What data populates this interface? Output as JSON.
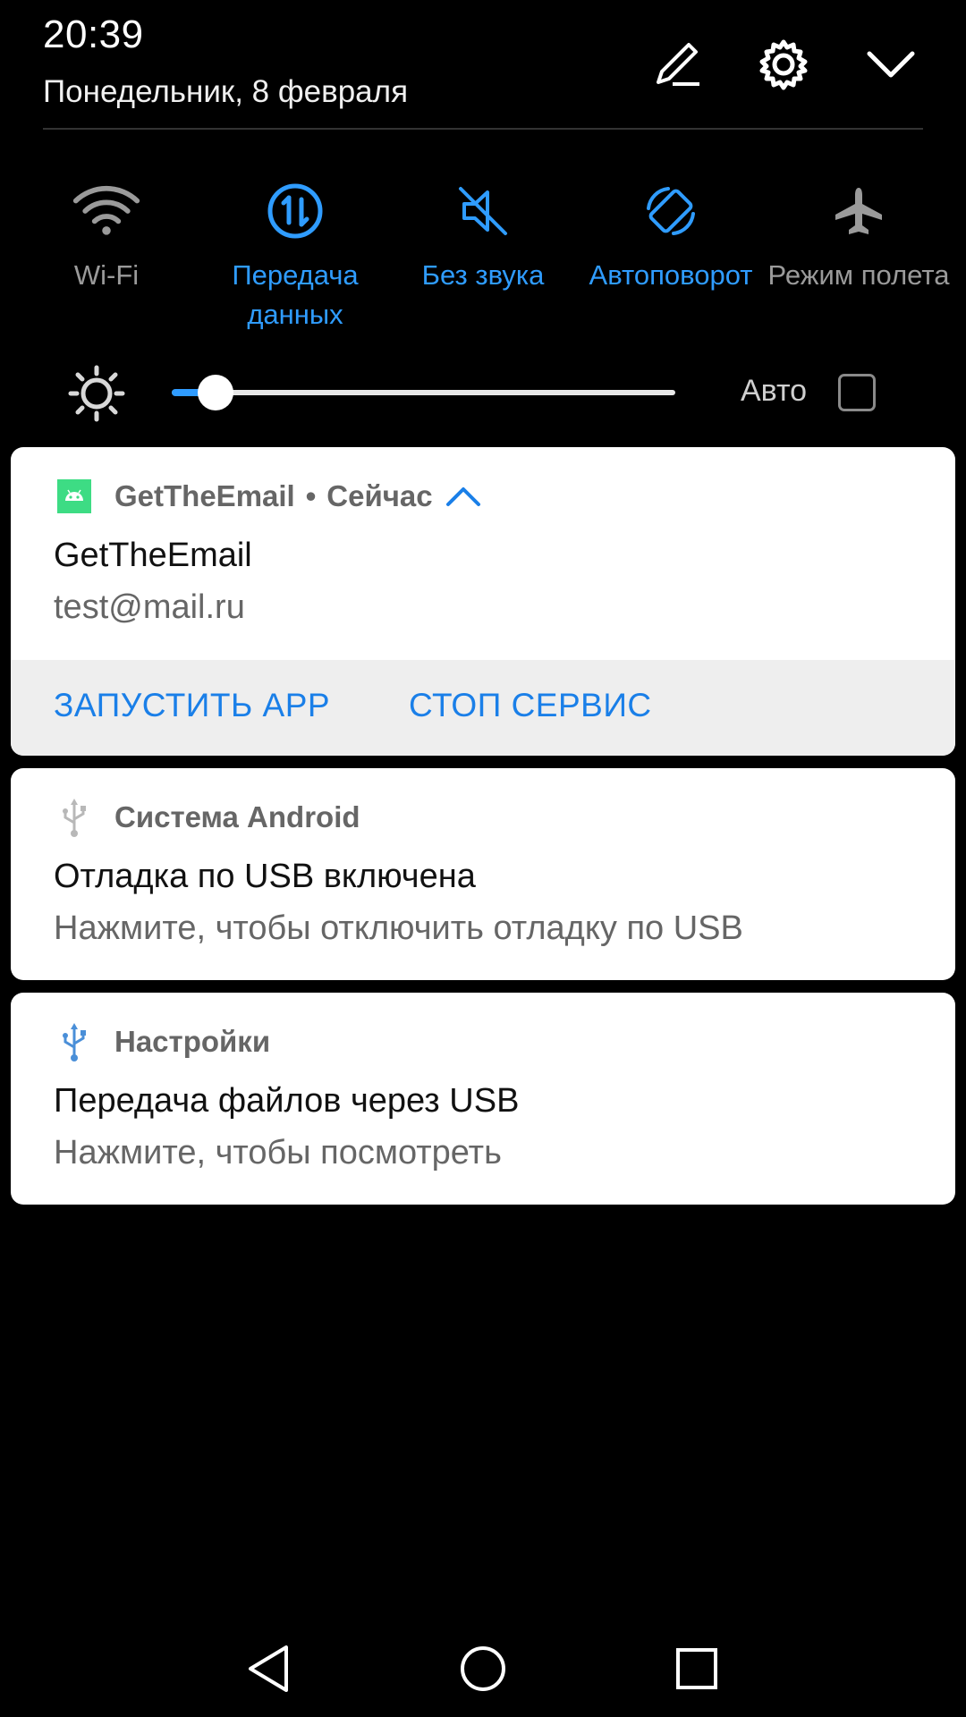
{
  "header": {
    "time": "20:39",
    "date": "Понедельник, 8 февраля",
    "icons": [
      "edit-icon",
      "settings-icon",
      "collapse-icon"
    ]
  },
  "quick_settings": {
    "tiles": [
      {
        "label": "Wi-Fi",
        "icon": "wifi-icon",
        "active": false
      },
      {
        "label": "Передача\nданных",
        "icon": "data-transfer-icon",
        "active": true
      },
      {
        "label": "Без звука",
        "icon": "mute-icon",
        "active": true
      },
      {
        "label": "Автоповорот",
        "icon": "auto-rotate-icon",
        "active": true
      },
      {
        "label": "Режим полета",
        "icon": "airplane-icon",
        "active": false
      }
    ],
    "brightness": {
      "level": 0.08,
      "auto_label": "Авто",
      "auto_checked": false
    }
  },
  "notifications": [
    {
      "app": "GetTheEmail",
      "time": "Сейчас",
      "separator": "•",
      "title": "GetTheEmail",
      "text": "test@mail.ru",
      "actions": [
        "ЗАПУСТИТЬ APP",
        "СТОП СЕРВИС"
      ]
    },
    {
      "app": "Система Android",
      "title": "Отладка по USB включена",
      "text": "Нажмите, чтобы отключить отладку по USB"
    },
    {
      "app": "Настройки",
      "title": "Передача файлов через USB",
      "text": "Нажмите, чтобы посмотреть"
    }
  ],
  "colors": {
    "accent": "#2f9cff",
    "inactive": "#9a9a9a",
    "action": "#1a7fe8",
    "android_green": "#3ddc84"
  }
}
